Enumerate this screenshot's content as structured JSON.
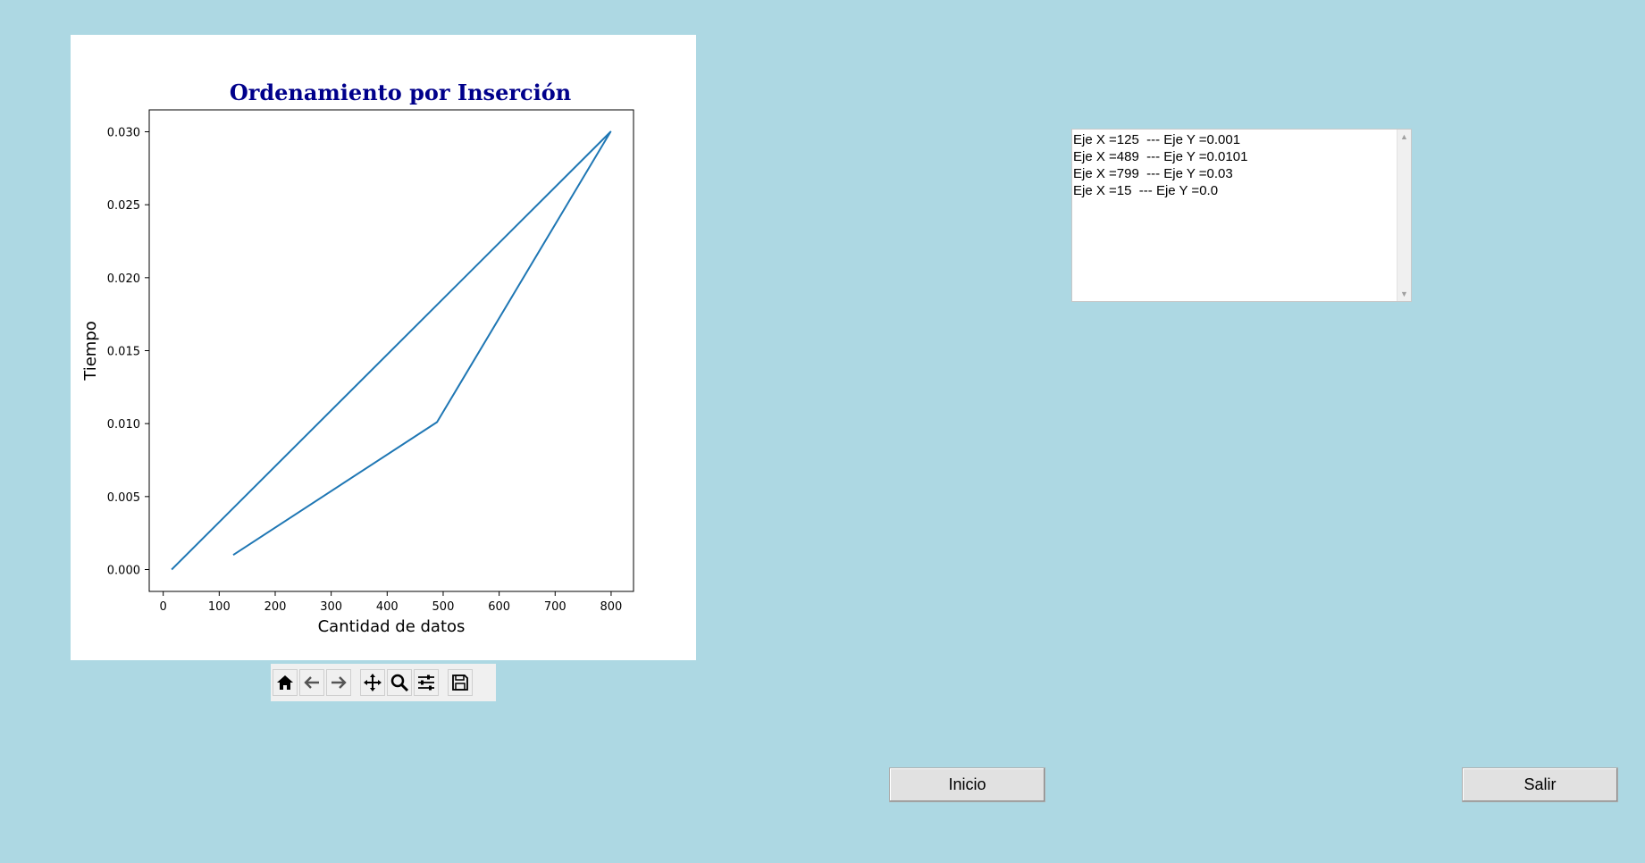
{
  "chart_data": {
    "type": "line",
    "title": "Ordenamiento por Inserción",
    "xlabel": "Cantidad de datos",
    "ylabel": "Tiempo",
    "x": [
      125,
      489,
      799,
      15
    ],
    "y": [
      0.001,
      0.0101,
      0.03,
      0.0
    ],
    "xlim": [
      -25,
      840
    ],
    "ylim": [
      -0.0015,
      0.0315
    ],
    "xticks": [
      0,
      100,
      200,
      300,
      400,
      500,
      600,
      700,
      800
    ],
    "xtick_labels": [
      "0",
      "100",
      "200",
      "300",
      "400",
      "500",
      "600",
      "700",
      "800"
    ],
    "yticks": [
      0.0,
      0.005,
      0.01,
      0.015,
      0.02,
      0.025,
      0.03
    ],
    "ytick_labels": [
      "0.000",
      "0.005",
      "0.010",
      "0.015",
      "0.020",
      "0.025",
      "0.030"
    ],
    "line_color": "#1f77b4",
    "title_color": "#00008b",
    "grid": false
  },
  "toolbar": {
    "buttons": [
      {
        "name": "home-icon",
        "glyph": "home"
      },
      {
        "name": "back-arrow-icon",
        "glyph": "back"
      },
      {
        "name": "forward-arrow-icon",
        "glyph": "forward"
      },
      {
        "name": "pan-icon",
        "glyph": "pan"
      },
      {
        "name": "zoom-icon",
        "glyph": "zoom"
      },
      {
        "name": "configure-subplots-icon",
        "glyph": "sliders"
      },
      {
        "name": "save-icon",
        "glyph": "save"
      }
    ]
  },
  "log": {
    "text": "Eje X =125  --- Eje Y =0.001\nEje X =489  --- Eje Y =0.0101\nEje X =799  --- Eje Y =0.03\nEje X =15  --- Eje Y =0.0"
  },
  "buttons": {
    "inicio": "Inicio",
    "salir": "Salir"
  },
  "colors": {
    "background": "#add8e3"
  }
}
